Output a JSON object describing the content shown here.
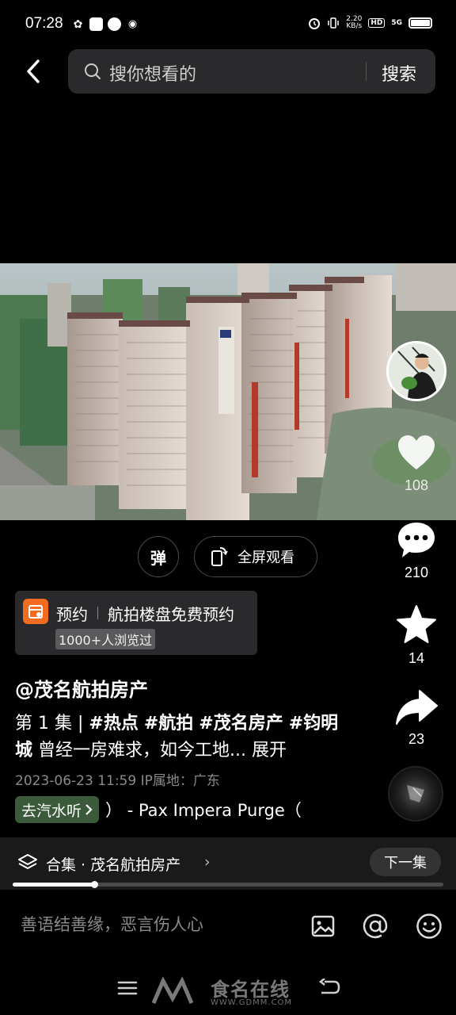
{
  "status_bar": {
    "time": "07:28",
    "net_speed_value": "2.20",
    "net_speed_unit": "KB/s",
    "hd": "HD",
    "network": "5G"
  },
  "search": {
    "placeholder": "搜你想看的",
    "button": "搜索"
  },
  "rail": {
    "likes": "108",
    "comments": "210",
    "favorites": "14",
    "shares": "23"
  },
  "controls": {
    "danmaku": "弹",
    "fullscreen": "全屏观看"
  },
  "booking": {
    "label": "预约",
    "title": "航拍楼盘免费预约",
    "views": "1000+人浏览过"
  },
  "post": {
    "author": "@茂名航拍房产",
    "episode": "第 1 集 | ",
    "tags": [
      "#热点",
      "#航拍",
      "#茂名房产",
      "#钧明城"
    ],
    "text": "曾经一房难求，如今工地...",
    "expand": "展开",
    "meta": "2023-06-23 11:59  IP属地：广东"
  },
  "music": {
    "chip": "去汽水听",
    "title": "） - Pax Impera    Purge（"
  },
  "collection": {
    "label": "合集 · 茂名航拍房产",
    "next": "下一集",
    "progress": 0.19
  },
  "comment": {
    "placeholder": "善语结善缘，恶言伤人心"
  },
  "watermark": {
    "title": "食名在线",
    "url": "WWW.GDMM.COM"
  },
  "colors": {
    "background": "#000000",
    "booking_icon": "#f26b21",
    "music_chip": "#3b5a3a"
  }
}
